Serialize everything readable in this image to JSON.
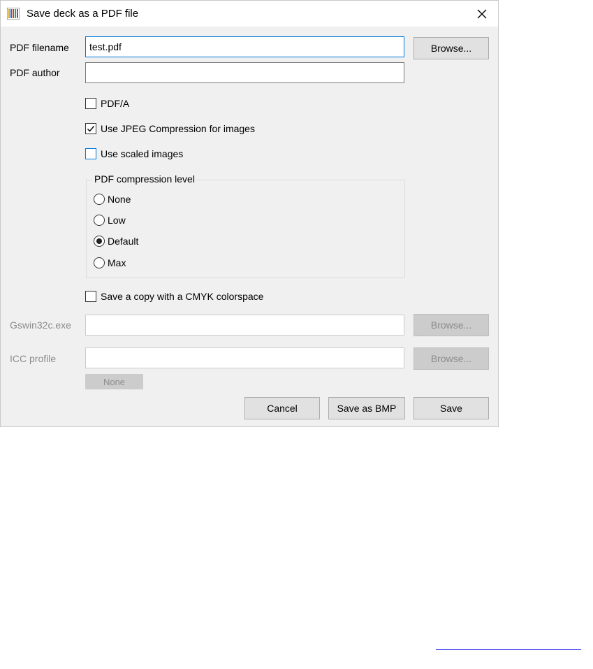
{
  "window": {
    "title": "Save deck as a PDF file",
    "close_glyph": "✕"
  },
  "fields": {
    "pdf_filename": {
      "label": "PDF filename",
      "value": "test.pdf",
      "browse": "Browse..."
    },
    "pdf_author": {
      "label": "PDF author",
      "value": ""
    },
    "gswin": {
      "label": "Gswin32c.exe",
      "value": "",
      "browse": "Browse..."
    },
    "icc": {
      "label": "ICC profile",
      "value": "",
      "browse": "Browse...",
      "none": "None"
    }
  },
  "options": {
    "pdfa": {
      "label": "PDF/A",
      "checked": false
    },
    "jpeg": {
      "label": "Use JPEG Compression for images",
      "checked": true
    },
    "scaled": {
      "label": "Use scaled images",
      "checked": false
    },
    "cmyk": {
      "label": "Save a copy with a CMYK colorspace",
      "checked": false
    }
  },
  "compression": {
    "title": "PDF compression level",
    "levels": [
      {
        "label": "None",
        "selected": false
      },
      {
        "label": "Low",
        "selected": false
      },
      {
        "label": "Default",
        "selected": true
      },
      {
        "label": "Max",
        "selected": false
      }
    ]
  },
  "buttons": {
    "cancel": "Cancel",
    "save_bmp": "Save as BMP",
    "save": "Save"
  },
  "colors": {
    "focus": "#0078d7",
    "dialog_bg": "#f0f0f0",
    "link": "#0000ee"
  }
}
